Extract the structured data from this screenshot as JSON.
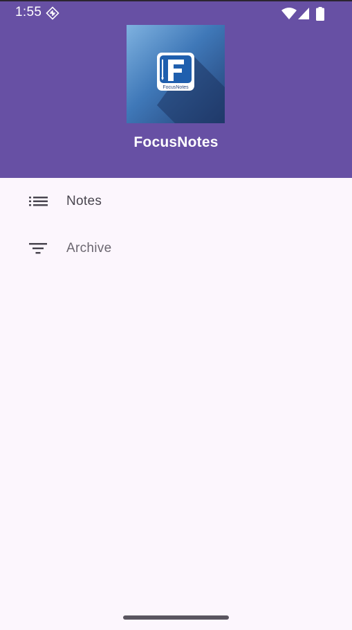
{
  "status_bar": {
    "time": "1:55",
    "notification_icon": "app-notification-icon",
    "wifi_icon": "wifi-icon",
    "signal_icon": "cell-signal-icon",
    "battery_icon": "battery-icon"
  },
  "drawer_header": {
    "logo_icon": "focusnotes-logo",
    "logo_text": "FocusNotes",
    "app_name": "FocusNotes",
    "background_color": "#6750a4"
  },
  "nav": {
    "items": [
      {
        "label": "Notes",
        "icon": "list-icon"
      },
      {
        "label": "Archive",
        "icon": "filter-icon"
      }
    ]
  },
  "colors": {
    "surface": "#fcf6fd",
    "primary": "#6750a4",
    "on_surface_variant": "#49454f"
  }
}
